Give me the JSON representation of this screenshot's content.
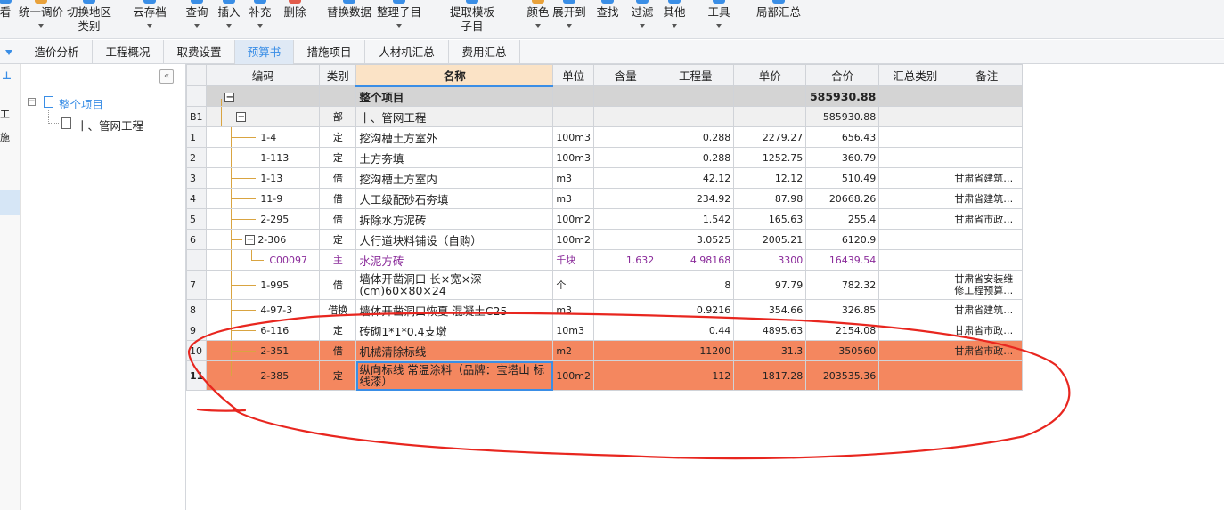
{
  "toolbar": {
    "items": [
      {
        "label": "看",
        "icon": "view-icon"
      },
      {
        "label": "统一调价",
        "icon": "price-adjust-icon"
      },
      {
        "label": "切换地区",
        "label2": "类别",
        "icon": "region-switch-icon"
      },
      {
        "label": "云存档",
        "icon": "cloud-save-icon"
      },
      {
        "label": "查询",
        "icon": "query-icon"
      },
      {
        "label": "插入",
        "icon": "insert-icon"
      },
      {
        "label": "补充",
        "icon": "supplement-icon"
      },
      {
        "label": "删除",
        "icon": "delete-icon"
      },
      {
        "label": "替换数据",
        "icon": "replace-data-icon"
      },
      {
        "label": "整理子目",
        "icon": "organize-subitems-icon"
      },
      {
        "label": "提取模板",
        "label2": "子目",
        "icon": "extract-template-icon"
      },
      {
        "label": "颜色",
        "icon": "color-icon"
      },
      {
        "label": "展开到",
        "icon": "expand-to-icon"
      },
      {
        "label": "查找",
        "icon": "find-icon"
      },
      {
        "label": "过滤",
        "icon": "filter-icon"
      },
      {
        "label": "其他",
        "icon": "other-icon"
      },
      {
        "label": "工具",
        "icon": "tools-icon"
      },
      {
        "label": "局部汇总",
        "icon": "partial-summary-icon"
      }
    ]
  },
  "tabs": [
    "造价分析",
    "工程概况",
    "取费设置",
    "预算书",
    "措施项目",
    "人材机汇总",
    "费用汇总"
  ],
  "active_tab": "预算书",
  "left_strip": {
    "t1": "工",
    "t2": "施",
    "pin": "⊥"
  },
  "tree": {
    "collapse_label": "«",
    "root": "整个项目",
    "child": "十、管网工程"
  },
  "grid": {
    "columns": [
      "",
      "编码",
      "类别",
      "名称",
      "单位",
      "含量",
      "工程量",
      "单价",
      "合价",
      "汇总类别",
      "备注"
    ],
    "rows": [
      {
        "rn": "",
        "code": "",
        "type": "",
        "name": "整个项目",
        "unit": "",
        "content": "",
        "qty": "",
        "price": "",
        "total": "585930.88",
        "sumcat": "",
        "note": "",
        "kind": "top"
      },
      {
        "rn": "B1",
        "code": "",
        "type": "部",
        "name": "十、管网工程",
        "unit": "",
        "content": "",
        "qty": "",
        "price": "",
        "total": "585930.88",
        "sumcat": "",
        "note": "",
        "kind": "dept"
      },
      {
        "rn": "1",
        "code": "1-4",
        "type": "定",
        "name": "挖沟槽土方室外",
        "unit": "100m3",
        "content": "",
        "qty": "0.288",
        "price": "2279.27",
        "total": "656.43",
        "sumcat": "",
        "note": "",
        "kind": "item"
      },
      {
        "rn": "2",
        "code": "1-113",
        "type": "定",
        "name": "土方夯填",
        "unit": "100m3",
        "content": "",
        "qty": "0.288",
        "price": "1252.75",
        "total": "360.79",
        "sumcat": "",
        "note": "",
        "kind": "item"
      },
      {
        "rn": "3",
        "code": "1-13",
        "type": "借",
        "name": "挖沟槽土方室内",
        "unit": "m3",
        "content": "",
        "qty": "42.12",
        "price": "12.12",
        "total": "510.49",
        "sumcat": "",
        "note": "甘肃省建筑…",
        "kind": "item"
      },
      {
        "rn": "4",
        "code": "11-9",
        "type": "借",
        "name": "人工级配砂石夯填",
        "unit": "m3",
        "content": "",
        "qty": "234.92",
        "price": "87.98",
        "total": "20668.26",
        "sumcat": "",
        "note": "甘肃省建筑…",
        "kind": "item"
      },
      {
        "rn": "5",
        "code": "2-295",
        "type": "借",
        "name": "拆除水方泥砖",
        "unit": "100m2",
        "content": "",
        "qty": "1.542",
        "price": "165.63",
        "total": "255.4",
        "sumcat": "",
        "note": "甘肃省市政…",
        "kind": "item"
      },
      {
        "rn": "6",
        "code": "2-306",
        "type": "定",
        "name": "人行道块料铺设（自购）",
        "unit": "100m2",
        "content": "",
        "qty": "3.0525",
        "price": "2005.21",
        "total": "6120.9",
        "sumcat": "",
        "note": "",
        "kind": "parent"
      },
      {
        "rn": "",
        "code": "C00097",
        "type": "主",
        "name": "水泥方砖",
        "unit": "千块",
        "content": "1.632",
        "qty": "4.98168",
        "price": "3300",
        "total": "16439.54",
        "sumcat": "",
        "note": "",
        "kind": "sub"
      },
      {
        "rn": "7",
        "code": "1-995",
        "type": "借",
        "name": "墙体开凿洞口 长×宽×深(cm)60×80×24",
        "unit": "个",
        "content": "",
        "qty": "8",
        "price": "97.79",
        "total": "782.32",
        "sumcat": "",
        "note": "甘肃省安装维修工程预算…",
        "kind": "tall"
      },
      {
        "rn": "8",
        "code": "4-97-3",
        "type": "借换",
        "name": "墙体开凿洞口恢夏 混凝土C25",
        "unit": "m3",
        "content": "",
        "qty": "0.9216",
        "price": "354.66",
        "total": "326.85",
        "sumcat": "",
        "note": "甘肃省建筑…",
        "kind": "item"
      },
      {
        "rn": "9",
        "code": "6-116",
        "type": "定",
        "name": "砖砌1*1*0.4支墩",
        "unit": "10m3",
        "content": "",
        "qty": "0.44",
        "price": "4895.63",
        "total": "2154.08",
        "sumcat": "",
        "note": "甘肃省市政…",
        "kind": "item"
      },
      {
        "rn": "10",
        "code": "2-351",
        "type": "借",
        "name": "机械清除标线",
        "unit": "m2",
        "content": "",
        "qty": "11200",
        "price": "31.3",
        "total": "350560",
        "sumcat": "",
        "note": "甘肃省市政…",
        "kind": "orange"
      },
      {
        "rn": "11",
        "code": "2-385",
        "type": "定",
        "name": "纵向标线 常温涂料（品牌：宝塔山 标线漆）",
        "unit": "100m2",
        "content": "",
        "qty": "112",
        "price": "1817.28",
        "total": "203535.36",
        "sumcat": "",
        "note": "",
        "kind": "orange-tall"
      }
    ]
  },
  "colors": {
    "accent": "#3a8ee6",
    "highlight_rows": "#f4875f",
    "annotation": "#e8261f",
    "tree_lines": "#d9a441"
  }
}
